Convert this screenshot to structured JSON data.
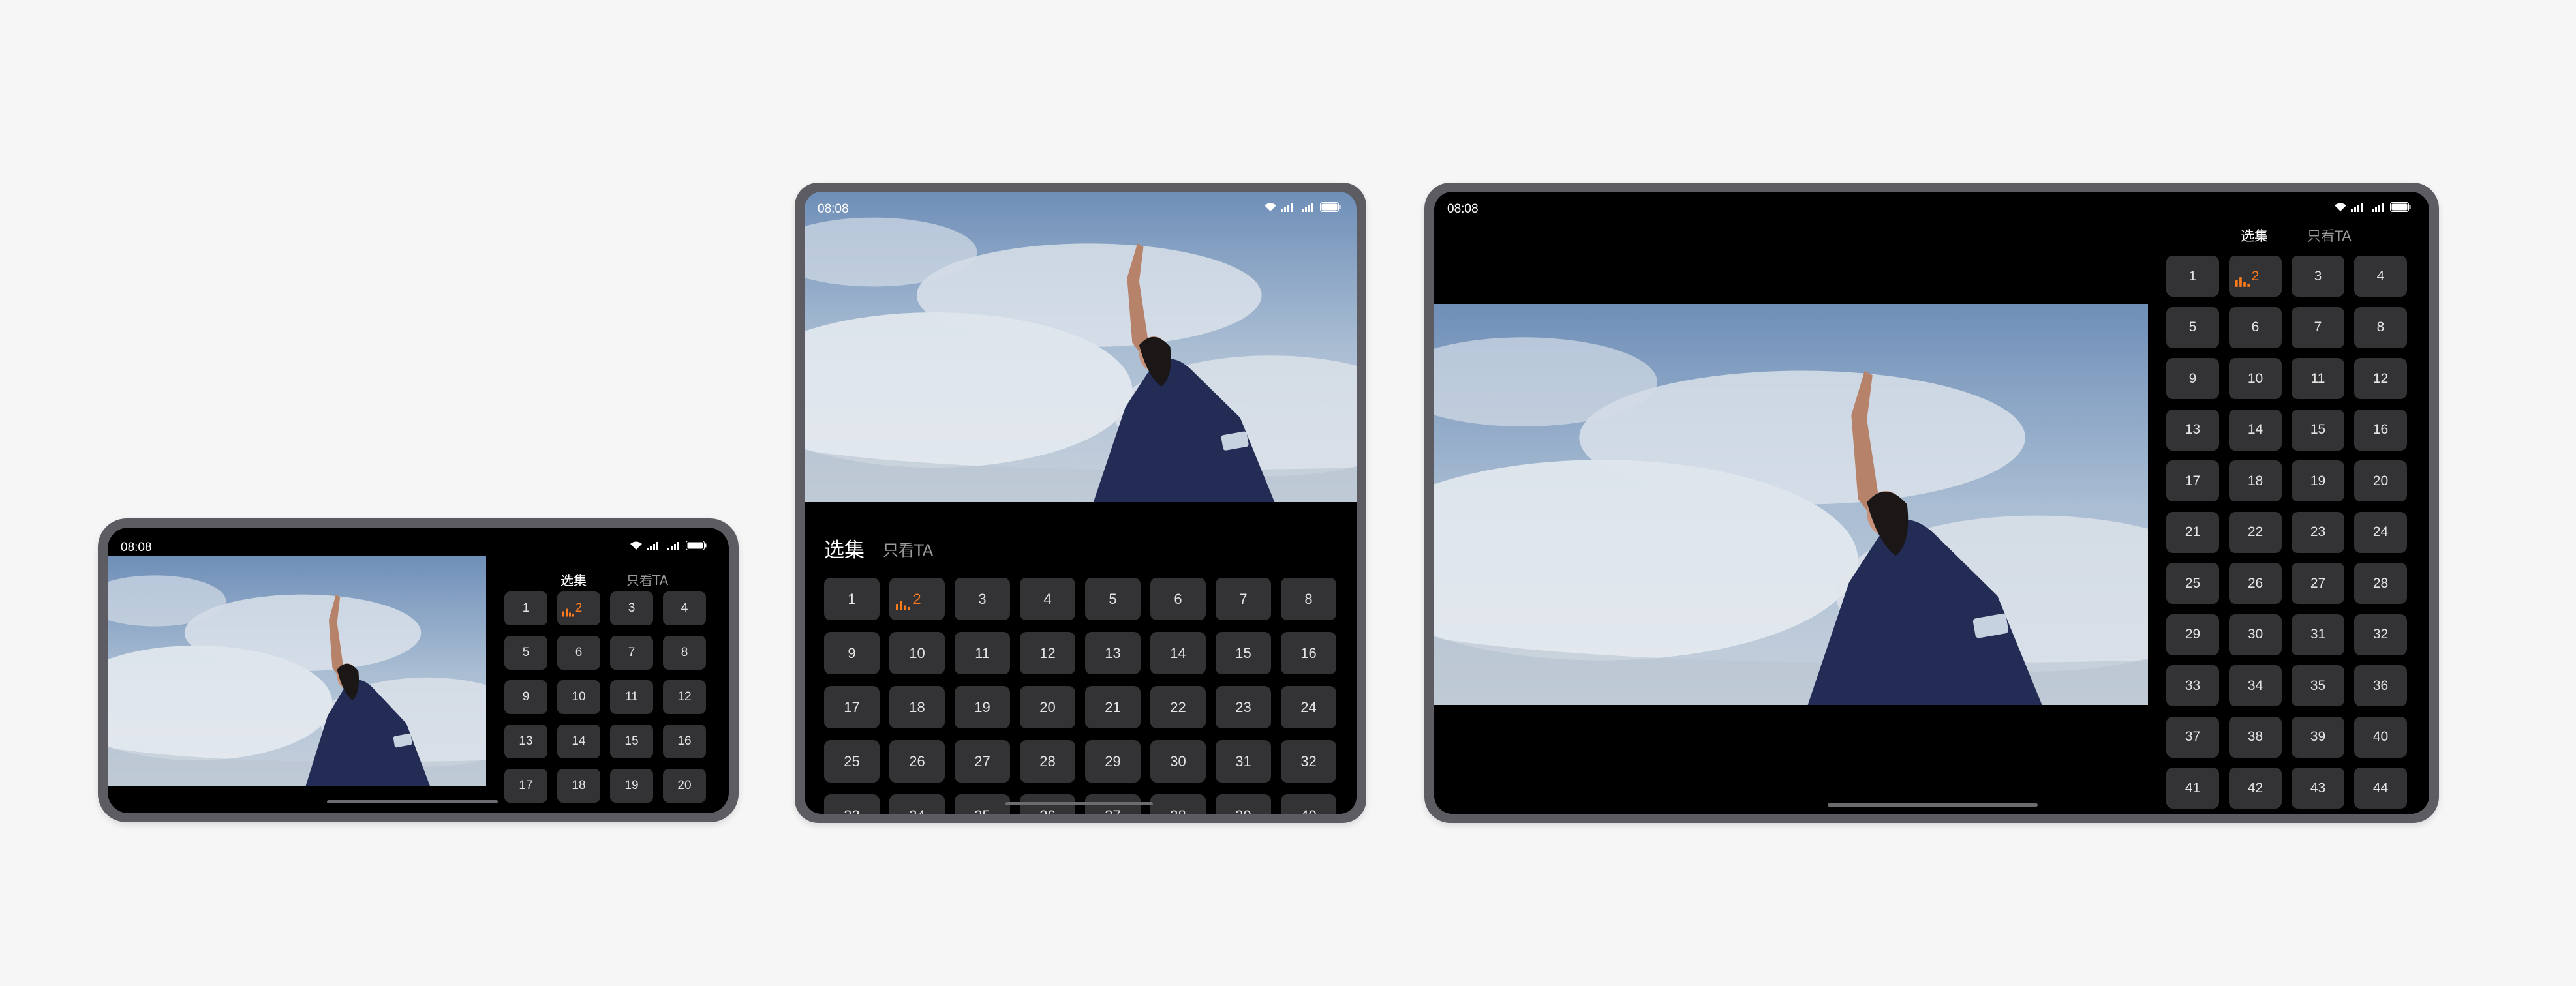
{
  "status": {
    "time": "08:08",
    "battery": "100"
  },
  "tabs": {
    "episodes": "选集",
    "only_ta": "只看TA"
  },
  "episodes": [
    "1",
    "2",
    "3",
    "4",
    "5",
    "6",
    "7",
    "8",
    "9",
    "10",
    "11",
    "12",
    "13",
    "14",
    "15",
    "16",
    "17",
    "18",
    "19",
    "20",
    "21",
    "22",
    "23",
    "24",
    "25",
    "26",
    "27",
    "28",
    "29",
    "30",
    "31",
    "32",
    "33",
    "34",
    "35",
    "36",
    "37",
    "38",
    "39",
    "40",
    "41",
    "42",
    "43",
    "44"
  ],
  "playing_episode": "2",
  "colors": {
    "accent": "#ff7a1a",
    "tile": "#333336",
    "frame": "#5c5c62",
    "background": "#f6f6f6"
  }
}
